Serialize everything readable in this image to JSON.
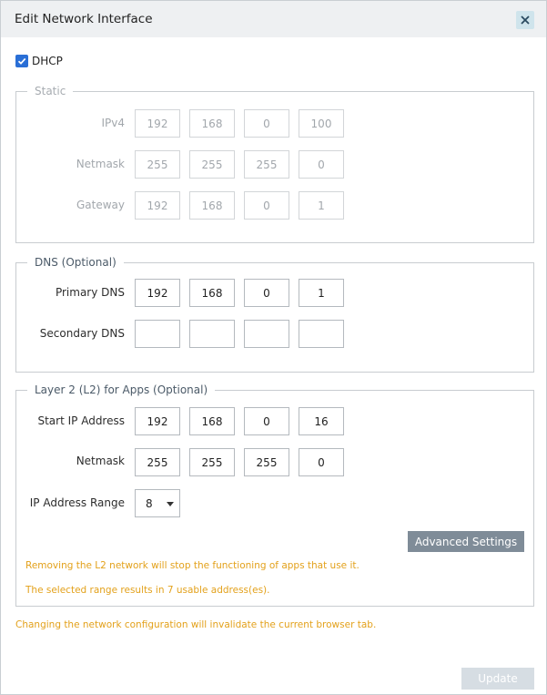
{
  "dialog": {
    "title": "Edit Network Interface",
    "close_icon": "close-icon"
  },
  "dhcp": {
    "label": "DHCP",
    "checked": true
  },
  "static": {
    "legend": "Static",
    "ipv4": {
      "label": "IPv4",
      "octets": [
        "192",
        "168",
        "0",
        "100"
      ]
    },
    "netmask": {
      "label": "Netmask",
      "octets": [
        "255",
        "255",
        "255",
        "0"
      ]
    },
    "gateway": {
      "label": "Gateway",
      "octets": [
        "192",
        "168",
        "0",
        "1"
      ]
    }
  },
  "dns": {
    "legend": "DNS (Optional)",
    "primary": {
      "label": "Primary DNS",
      "octets": [
        "192",
        "168",
        "0",
        "1"
      ]
    },
    "secondary": {
      "label": "Secondary DNS",
      "octets": [
        "",
        "",
        "",
        ""
      ]
    }
  },
  "l2": {
    "legend": "Layer 2 (L2) for Apps (Optional)",
    "start_ip": {
      "label": "Start IP Address",
      "octets": [
        "192",
        "168",
        "0",
        "16"
      ]
    },
    "netmask": {
      "label": "Netmask",
      "octets": [
        "255",
        "255",
        "255",
        "0"
      ]
    },
    "range": {
      "label": "IP Address Range",
      "value": "8"
    },
    "advanced_button": "Advanced Settings",
    "warning_remove": "Removing the L2 network will stop the functioning of apps that use it.",
    "warning_range": "The selected range results in 7 usable address(es)."
  },
  "footer": {
    "warning": "Changing the network configuration will invalidate the current browser tab.",
    "update_button": "Update"
  },
  "colors": {
    "accent": "#2a6fd6",
    "warning": "#e3a11b",
    "button": "#7f8c98",
    "disabled_button": "#d6dde3"
  }
}
